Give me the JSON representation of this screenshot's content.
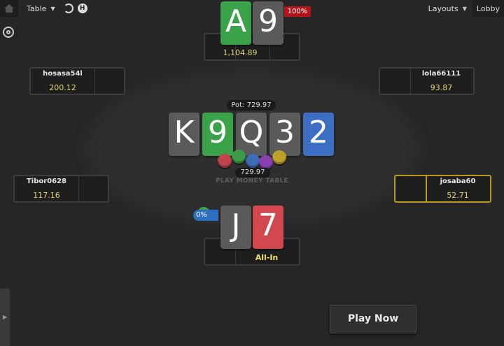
{
  "topbar": {
    "table_label": "Table",
    "layouts_label": "Layouts",
    "lobby_label": "Lobby"
  },
  "table": {
    "play_money_label": "PLAY MONEY TABLE",
    "pot_label": "Pot: 729.97",
    "pot_amount": "729.97",
    "board": [
      {
        "rank": "K",
        "color": "gray"
      },
      {
        "rank": "9",
        "color": "green"
      },
      {
        "rank": "Q",
        "color": "gray"
      },
      {
        "rank": "3",
        "color": "gray"
      },
      {
        "rank": "2",
        "color": "blue"
      }
    ]
  },
  "seats": {
    "top": {
      "stack": "1,104.89",
      "cards": [
        {
          "rank": "A",
          "color": "green"
        },
        {
          "rank": "9",
          "color": "gray"
        }
      ],
      "equity": "100%"
    },
    "top_left": {
      "name": "hosasa54l",
      "stack": "200.12"
    },
    "top_right": {
      "name": "lola66111",
      "stack": "93.87"
    },
    "left": {
      "name": "Tibor0628",
      "stack": "117.16"
    },
    "right": {
      "name": "josaba60",
      "stack": "52.71"
    },
    "hero": {
      "status": "All-In",
      "cards": [
        {
          "rank": "J",
          "color": "gray"
        },
        {
          "rank": "7",
          "color": "red"
        }
      ],
      "equity": "0%"
    }
  },
  "play_now_label": "Play Now",
  "colors": {
    "felt": "#2e2e2e",
    "background": "#262626",
    "stack_text": "#e2d66a",
    "highlight": "#b89a18",
    "equity_loss": "#2c6ec0",
    "equity_win": "#b3151b"
  },
  "icons": [
    "home-icon",
    "refresh-icon",
    "hand-history-icon",
    "target-icon",
    "chevron-down-icon"
  ]
}
